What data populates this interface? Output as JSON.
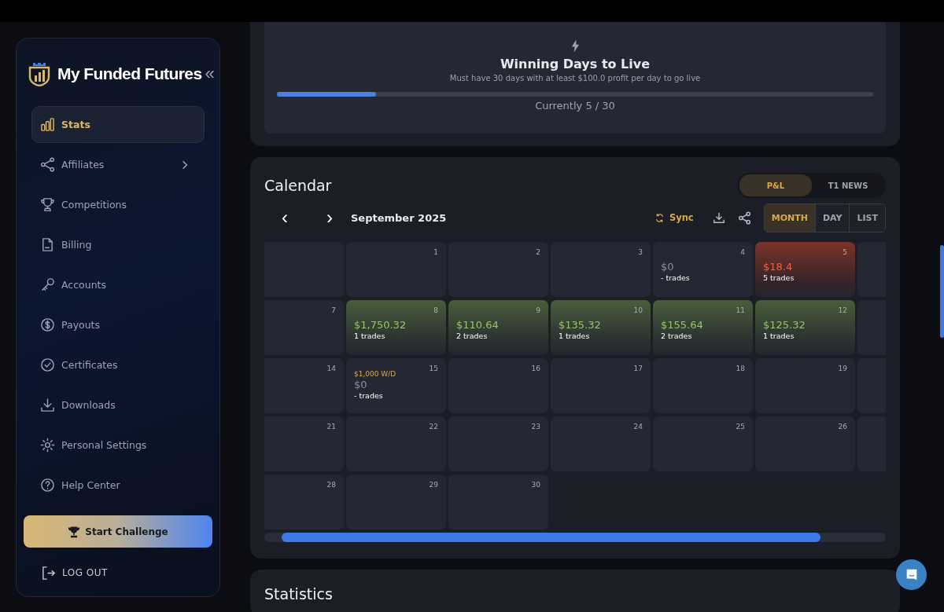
{
  "brand": {
    "name": "My Funded Futures",
    "collapse": "«"
  },
  "sidebar": {
    "items": [
      {
        "label": "Stats",
        "selected": true,
        "has_submenu": false
      },
      {
        "label": "Affiliates",
        "selected": false,
        "has_submenu": true
      },
      {
        "label": "Competitions",
        "selected": false,
        "has_submenu": false
      },
      {
        "label": "Billing",
        "selected": false,
        "has_submenu": false
      },
      {
        "label": "Accounts",
        "selected": false,
        "has_submenu": false
      },
      {
        "label": "Payouts",
        "selected": false,
        "has_submenu": false
      },
      {
        "label": "Certificates",
        "selected": false,
        "has_submenu": false
      },
      {
        "label": "Downloads",
        "selected": false,
        "has_submenu": false
      },
      {
        "label": "Personal Settings",
        "selected": false,
        "has_submenu": false
      },
      {
        "label": "Help Center",
        "selected": false,
        "has_submenu": false
      }
    ],
    "cta": "Start Challenge",
    "logout": "LOG OUT"
  },
  "goal": {
    "title": "Winning Days to Live",
    "subtitle": "Must have 30 days with at least $100.0 profit per day to go live",
    "level": 0.1667,
    "progress_text": "Currently 5 / 30"
  },
  "calendar": {
    "title": "Calendar",
    "tabs": [
      {
        "label": "P&L",
        "selected": true
      },
      {
        "label": "T1 NEWS",
        "selected": false
      }
    ],
    "prev": "‹",
    "next": "›",
    "month": "September 2025",
    "sync": "Sync",
    "views": [
      {
        "label": "MONTH",
        "selected": true
      },
      {
        "label": "DAY",
        "selected": false
      },
      {
        "label": "LIST",
        "selected": false
      }
    ],
    "weeks": [
      [
        {
          "kind": "blank"
        },
        {
          "kind": "plain",
          "day": "1"
        },
        {
          "kind": "plain",
          "day": "2"
        },
        {
          "kind": "plain",
          "day": "3"
        },
        {
          "kind": "flat",
          "day": "4",
          "pnl": "$0",
          "trades": "- trades"
        },
        {
          "kind": "loss",
          "day": "5",
          "pnl": "$18.4",
          "trades": "5 trades"
        },
        {
          "kind": "blank"
        }
      ],
      [
        {
          "kind": "plain",
          "day": "7"
        },
        {
          "kind": "profit",
          "day": "8",
          "pnl": "$1,750.32",
          "trades": "1 trades"
        },
        {
          "kind": "profit",
          "day": "9",
          "pnl": "$110.64",
          "trades": "2 trades"
        },
        {
          "kind": "profit",
          "day": "10",
          "pnl": "$135.32",
          "trades": "1 trades"
        },
        {
          "kind": "profit",
          "day": "11",
          "pnl": "$155.64",
          "trades": "2 trades"
        },
        {
          "kind": "profit",
          "day": "12",
          "pnl": "$125.32",
          "trades": "1 trades"
        },
        {
          "kind": "blank"
        }
      ],
      [
        {
          "kind": "plain",
          "day": "14"
        },
        {
          "kind": "flat",
          "day": "15",
          "note": "$1,000 W/D",
          "pnl": "$0",
          "trades": "- trades"
        },
        {
          "kind": "plain",
          "day": "16"
        },
        {
          "kind": "plain",
          "day": "17"
        },
        {
          "kind": "plain",
          "day": "18"
        },
        {
          "kind": "plain",
          "day": "19"
        },
        {
          "kind": "blank"
        }
      ],
      [
        {
          "kind": "plain",
          "day": "21"
        },
        {
          "kind": "plain",
          "day": "22"
        },
        {
          "kind": "plain",
          "day": "23"
        },
        {
          "kind": "plain",
          "day": "24"
        },
        {
          "kind": "plain",
          "day": "25"
        },
        {
          "kind": "plain",
          "day": "26"
        },
        {
          "kind": "blank"
        }
      ],
      [
        {
          "kind": "plain",
          "day": "28"
        },
        {
          "kind": "plain",
          "day": "29"
        },
        {
          "kind": "plain",
          "day": "30"
        }
      ]
    ]
  },
  "statistics": {
    "title": "Statistics"
  }
}
